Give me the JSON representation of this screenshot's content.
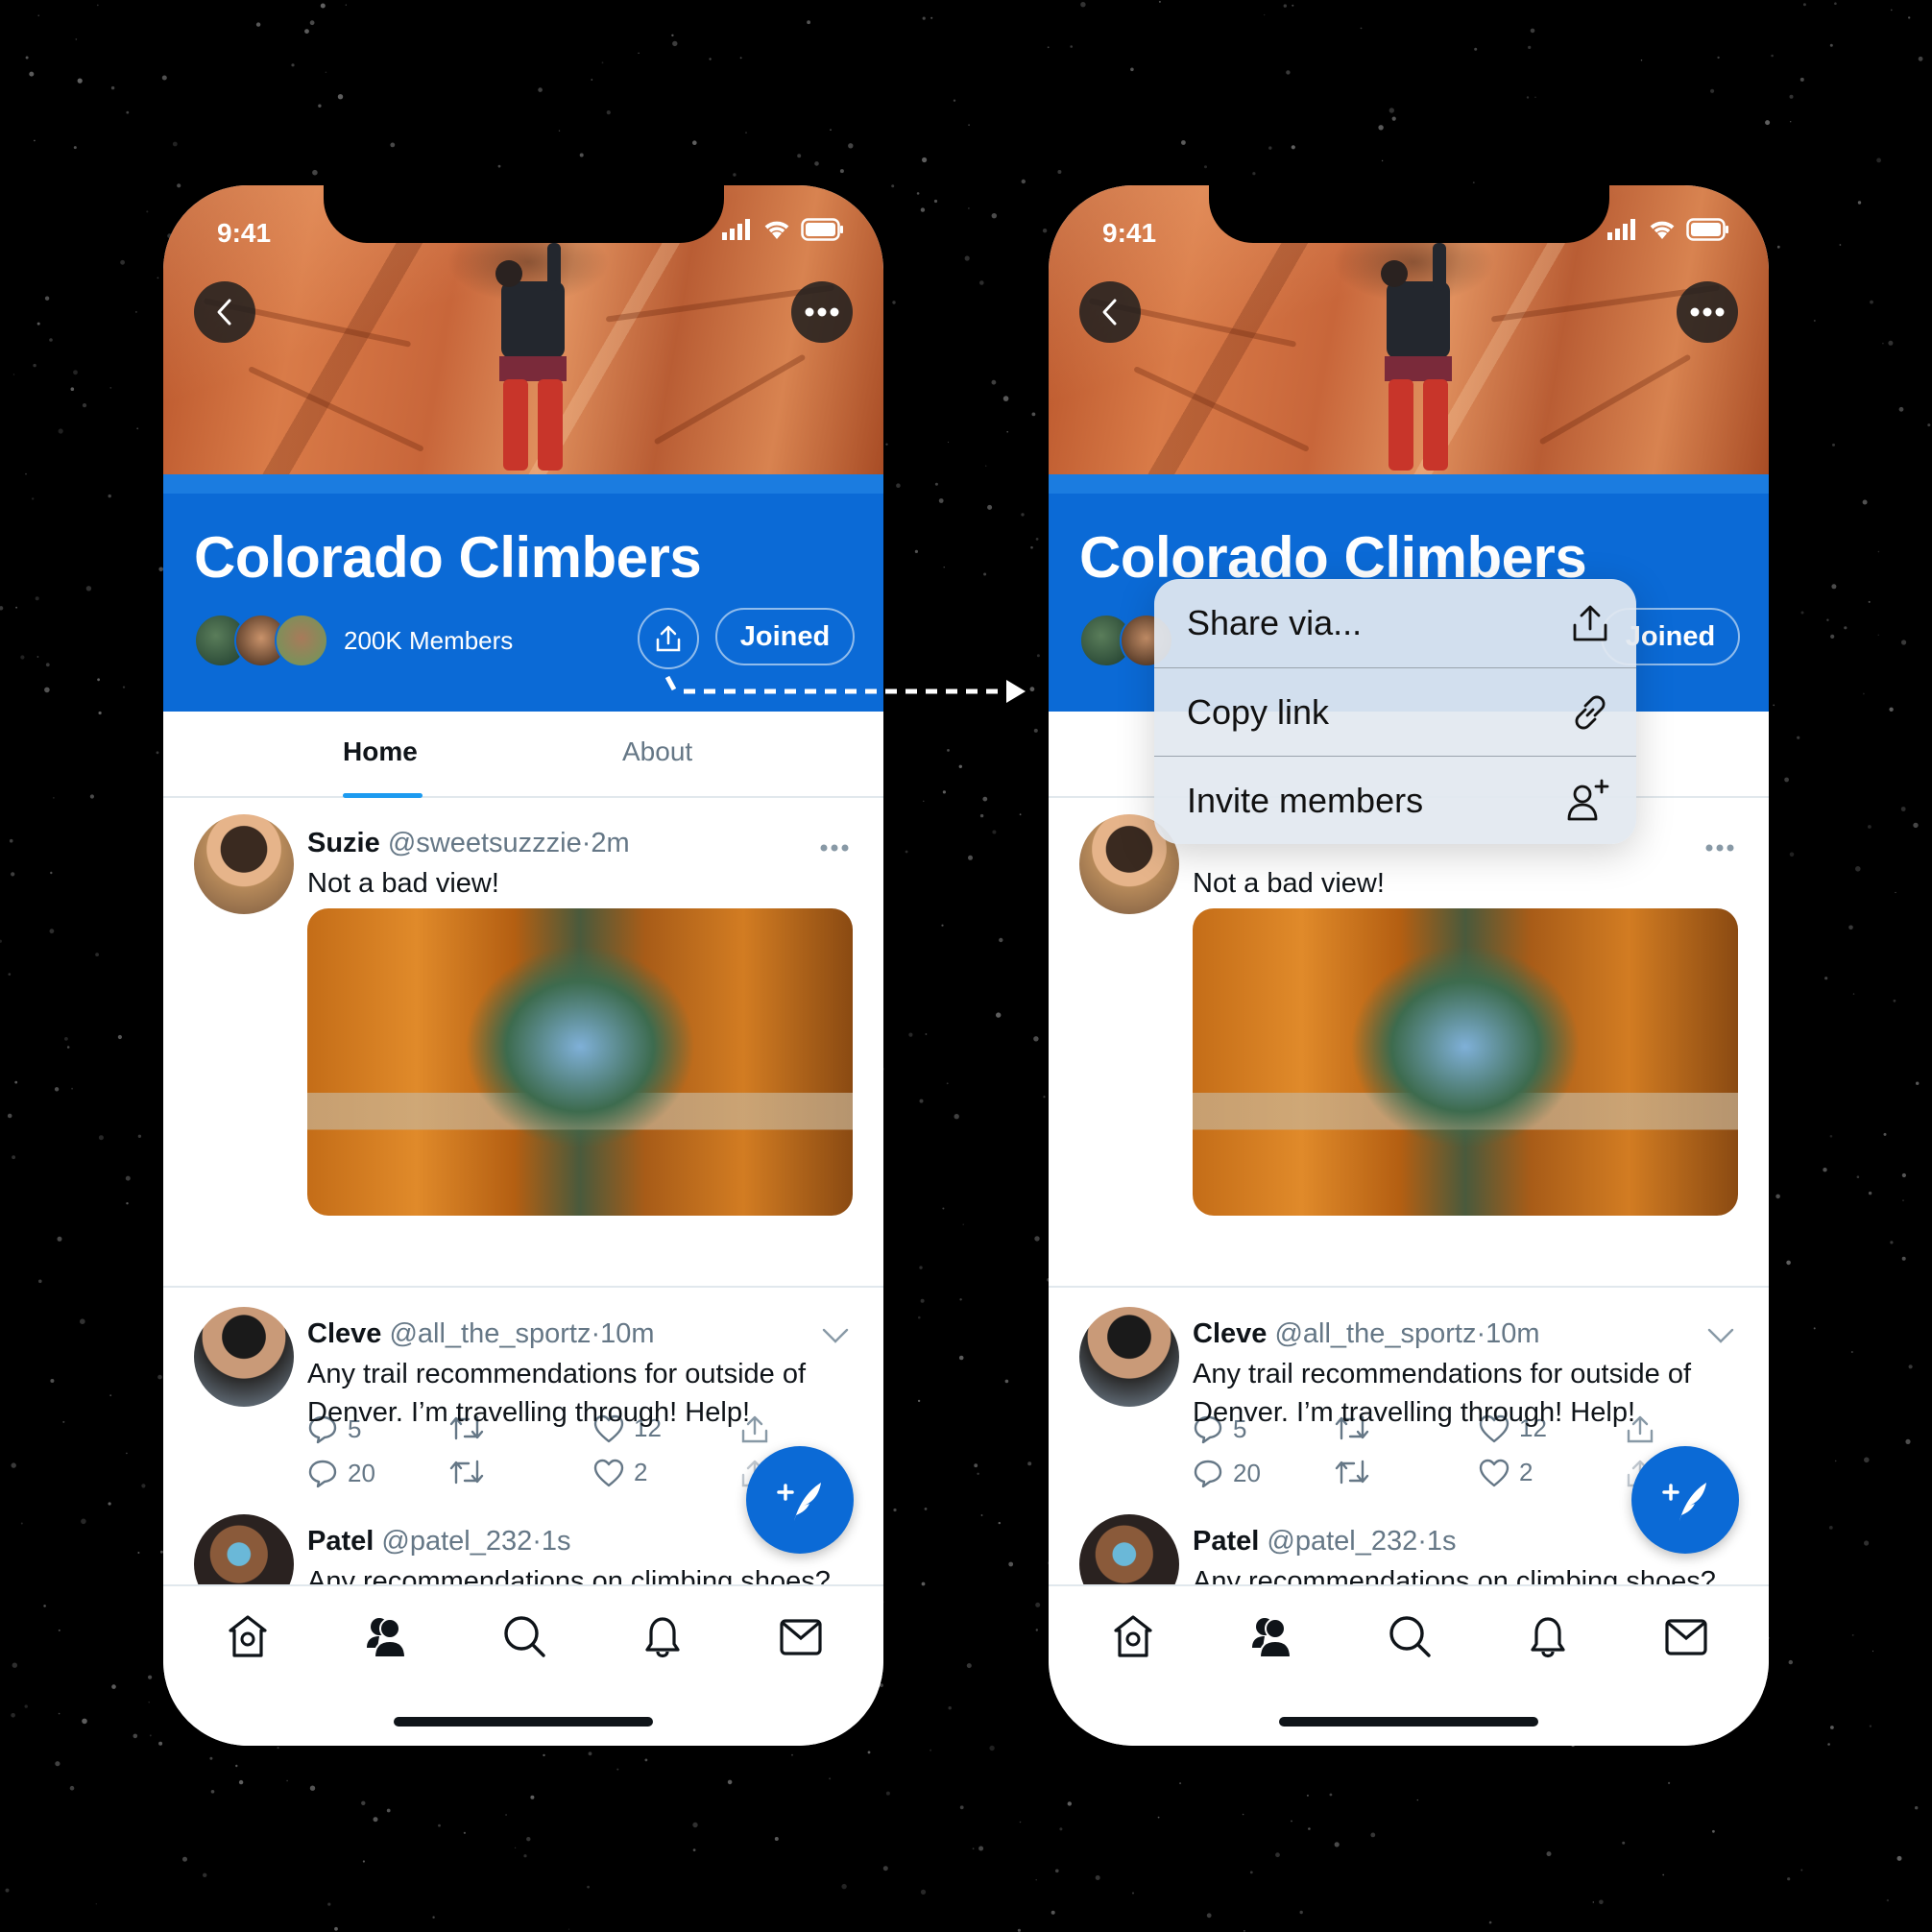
{
  "colors": {
    "brand_blue": "#0b6ad6",
    "tab_underline": "#1d9bf0",
    "text_primary": "#0f1419",
    "text_secondary": "#657786",
    "background": "#000000"
  },
  "phones": [
    {
      "id": "before",
      "status_bar": {
        "time": "9:41",
        "icons": [
          "signal-icon",
          "wifi-icon",
          "battery-icon"
        ]
      },
      "header": {
        "back_icon": "chevron-left-icon",
        "more_icon": "more-horizontal-icon"
      },
      "community": {
        "title": "Colorado Climbers",
        "members_label": "200K Members",
        "share_icon": "share-icon",
        "joined_label": "Joined"
      },
      "tabs": [
        {
          "label": "Home",
          "active": true
        },
        {
          "label": "About",
          "active": false
        }
      ],
      "tweets": [
        {
          "name": "Suzie",
          "handle": "@sweetsuzzzie",
          "time": "2m",
          "text": "Not a bad view!",
          "has_media": true,
          "media_alt": "View from inside a tent looking out at a forest campsite",
          "replies": "5",
          "retweets": "",
          "likes": "12",
          "menu": "more-horizontal-icon"
        },
        {
          "name": "Cleve",
          "handle": "@all_the_sportz",
          "time": "10m",
          "text_lines": [
            "Any trail recommendations for outside of",
            "Denver. I’m travelling through! Help!"
          ],
          "replies": "20",
          "retweets": "",
          "likes": "2",
          "menu": "chevron-down-icon"
        },
        {
          "name": "Patel",
          "handle": "@patel_232",
          "time": "1s",
          "text": "Any recommendations on climbing shoes?"
        }
      ],
      "fab_icon": "compose-tweet-icon",
      "bottom_nav": [
        "home-icon",
        "communities-icon",
        "search-icon",
        "notifications-icon",
        "messages-icon"
      ],
      "separator": "·"
    },
    {
      "id": "after",
      "status_bar": {
        "time": "9:41"
      },
      "community": {
        "title": "Colorado Climbers",
        "joined_label": "Joined"
      },
      "tweets": [
        {
          "text": "Not a bad view!",
          "replies": "5",
          "likes": "12"
        },
        {
          "name": "Cleve",
          "handle": "@all_the_sportz",
          "time": "10m",
          "text_lines": [
            "Any trail recommendations for outside of",
            "Denver. I’m travelling through! Help!"
          ],
          "replies": "20",
          "likes": "2"
        },
        {
          "name": "Patel",
          "handle": "@patel_232",
          "time": "1s",
          "text": "Any recommendations on climbing shoes?"
        }
      ],
      "context_menu": {
        "items": [
          {
            "label": "Share via...",
            "icon": "share-icon"
          },
          {
            "label": "Copy link",
            "icon": "link-icon"
          },
          {
            "label": "Invite members",
            "icon": "add-user-icon"
          }
        ]
      }
    }
  ]
}
